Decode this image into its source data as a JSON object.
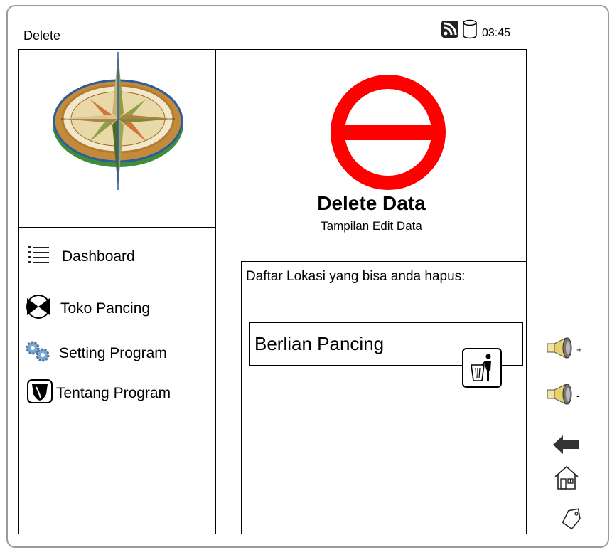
{
  "window": {
    "title": "Delete"
  },
  "status_bar": {
    "time": "03:45",
    "icons": [
      "rss-icon",
      "database-icon"
    ]
  },
  "sidebar": {
    "logo": "compass-logo",
    "items": [
      {
        "label": "Dashboard",
        "icon": "list-icon"
      },
      {
        "label": "Toko Pancing",
        "icon": "fish-icon"
      },
      {
        "label": "Setting Program",
        "icon": "gears-icon"
      },
      {
        "label": "Tentang Program",
        "icon": "shield-icon"
      }
    ]
  },
  "main": {
    "heading": "Delete Data",
    "subheading": "Tampilan Edit Data",
    "list_caption": "Daftar Lokasi yang bisa anda hapus:",
    "items": [
      {
        "label": "Berlian Pancing"
      }
    ]
  },
  "side_controls": {
    "volume_up_label": "+",
    "volume_down_label": "-"
  },
  "colors": {
    "delete_icon": "#ff0000"
  }
}
